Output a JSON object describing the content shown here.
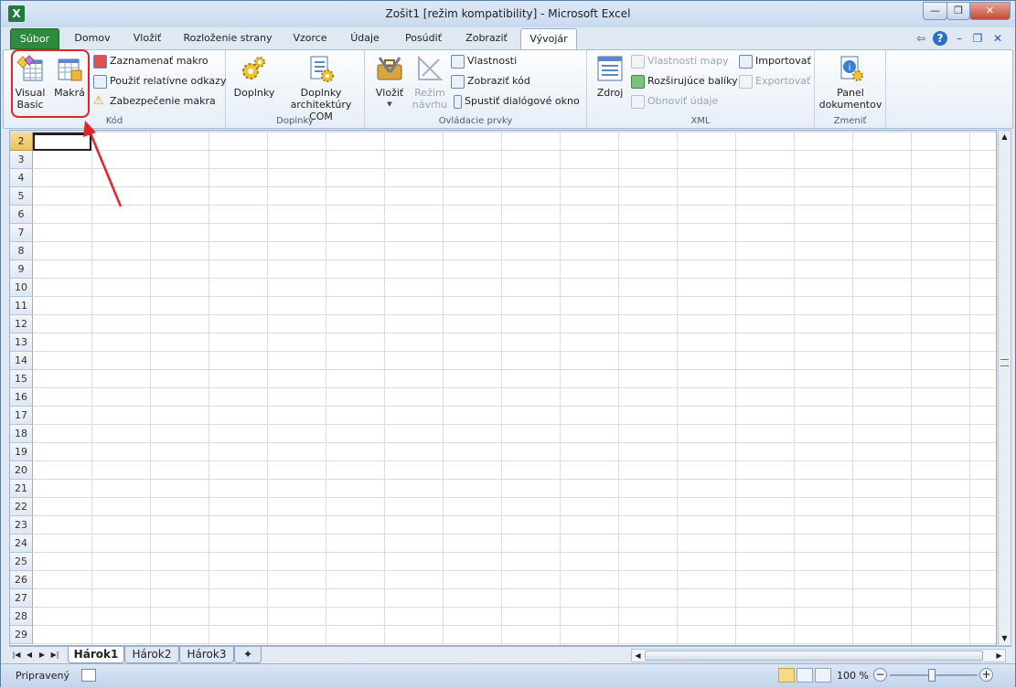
{
  "window": {
    "title": "Zošit1  [režim kompatibility]  -  Microsoft Excel",
    "app_icon": "excel-icon",
    "controls": [
      "minimize-icon",
      "restore-icon",
      "close-icon"
    ]
  },
  "ribbon_tabs": [
    {
      "label": "Súbor",
      "kind": "file"
    },
    {
      "label": "Domov"
    },
    {
      "label": "Vložiť"
    },
    {
      "label": "Rozloženie strany"
    },
    {
      "label": "Vzorce"
    },
    {
      "label": "Údaje"
    },
    {
      "label": "Posúdiť"
    },
    {
      "label": "Zobraziť"
    },
    {
      "label": "Vývojár",
      "active": true
    }
  ],
  "groups": {
    "kod": {
      "label": "Kód",
      "visual_basic": "Visual\nBasic",
      "makra": "Makrá",
      "record": "Zaznamenať makro",
      "relative": "Použiť relatívne odkazy",
      "security": "Zabezpečenie makra"
    },
    "doplnky": {
      "label": "Doplnky",
      "addins": "Doplnky",
      "com": "Doplnky\narchitektúry COM"
    },
    "ovladacie": {
      "label": "Ovládacie prvky",
      "insert": "Vložiť",
      "design": "Režim\nnávrhu",
      "properties": "Vlastnosti",
      "view_code": "Zobraziť kód",
      "dialog": "Spustiť dialógové okno"
    },
    "xml": {
      "label": "XML",
      "source": "Zdroj",
      "map_props": "Vlastnosti mapy",
      "expansion": "Rozširujúce balíky",
      "refresh": "Obnoviť údaje",
      "import": "Importovať",
      "export": "Exportovať"
    },
    "zmenit": {
      "label": "Zmeniť",
      "panel": "Panel\ndokumentov"
    }
  },
  "rows": [
    "2",
    "3",
    "4",
    "5",
    "6",
    "7",
    "8",
    "9",
    "10",
    "11",
    "12",
    "13",
    "14",
    "15",
    "16",
    "17",
    "18",
    "19",
    "20",
    "21",
    "22",
    "23",
    "24",
    "25",
    "26",
    "27",
    "28",
    "29"
  ],
  "sheets": {
    "tabs": [
      "Hárok1",
      "Hárok2",
      "Hárok3"
    ],
    "active": "Hárok1"
  },
  "status": {
    "ready": "Pripravený",
    "zoom": "100 %"
  },
  "colors": {
    "file_tab": "#2d8a3e",
    "highlight": "#e3232a"
  }
}
